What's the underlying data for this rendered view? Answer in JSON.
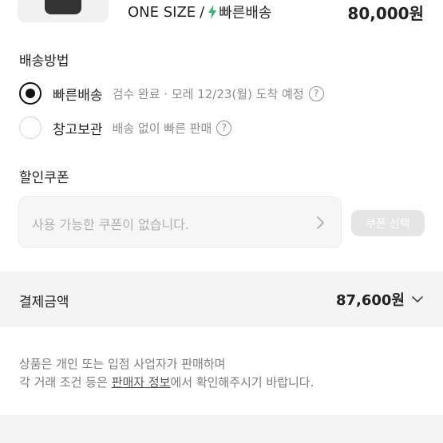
{
  "product": {
    "size": "ONE SIZE",
    "separator": "/",
    "shipping_tag": "빠른배송",
    "price": "80,000원"
  },
  "shipping": {
    "title": "배송방법",
    "options": [
      {
        "label": "빠른배송",
        "desc": "검수 완료 · 모레 12/23(월) 도착 예정",
        "selected": true
      },
      {
        "label": "창고보관",
        "desc": "배송 없이 빠른 판매",
        "selected": false
      }
    ],
    "help_glyph": "?"
  },
  "coupon": {
    "title": "할인쿠폰",
    "placeholder": "사용 가능한 쿠폰이 없습니다.",
    "button_label": "쿠폰 선택"
  },
  "payment": {
    "label": "결제금액",
    "amount": "87,600원"
  },
  "notice": {
    "line1": "상품은 개인 또는 입점 사업자가 판매하며",
    "line2_prefix": "각 거래 조건 등은 ",
    "line2_link": "판매자 정보",
    "line2_suffix": "에서 확인해주시기 바랍니다."
  },
  "colors": {
    "accent_green": "#31b46e",
    "text_primary": "#222222",
    "text_secondary": "#8e8e8e"
  },
  "icons": {
    "bolt": "lightning-bolt-icon",
    "help": "question-circle-icon",
    "chevron_right": "chevron-right-icon",
    "chevron_down": "chevron-down-icon"
  }
}
